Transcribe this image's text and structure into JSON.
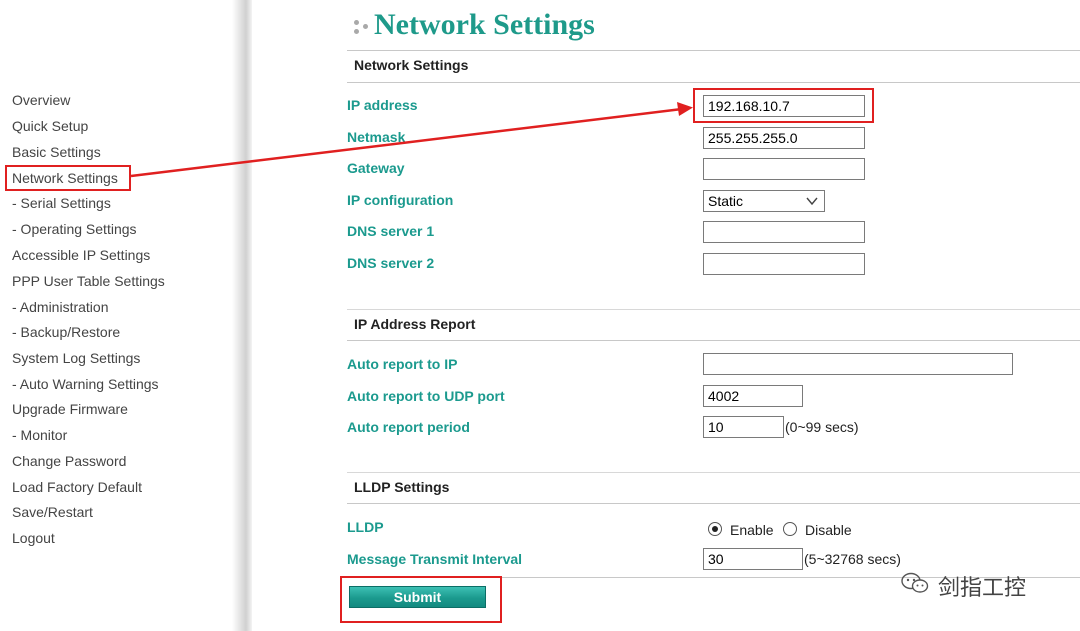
{
  "sidebar": {
    "items": [
      "Overview",
      "Quick Setup",
      "Basic Settings",
      "Network Settings",
      "- Serial Settings",
      "- Operating Settings",
      "Accessible IP Settings",
      "PPP User Table Settings",
      "- Administration",
      "- Backup/Restore",
      "System Log Settings",
      "- Auto Warning Settings",
      "Upgrade Firmware",
      "- Monitor",
      "Change Password",
      "Load Factory Default",
      "Save/Restart",
      "Logout"
    ],
    "active": "Network Settings"
  },
  "page": {
    "title": "Network Settings"
  },
  "network": {
    "header": "Network Settings",
    "ip_label": "IP address",
    "ip_value": "192.168.10.7",
    "netmask_label": "Netmask",
    "netmask_value": "255.255.255.0",
    "gateway_label": "Gateway",
    "gateway_value": "",
    "ipconf_label": "IP configuration",
    "ipconf_value": "Static",
    "dns1_label": "DNS server 1",
    "dns1_value": "",
    "dns2_label": "DNS server 2",
    "dns2_value": ""
  },
  "report": {
    "header": "IP Address Report",
    "ip_label": "Auto report to IP",
    "ip_value": "",
    "udp_label": "Auto report to UDP port",
    "udp_value": "4002",
    "period_label": "Auto report period",
    "period_value": "10",
    "period_hint": "(0~99 secs)"
  },
  "lldp": {
    "header": "LLDP Settings",
    "lldp_label": "LLDP",
    "enable_label": "Enable",
    "disable_label": "Disable",
    "selected": "Enable",
    "interval_label": "Message Transmit Interval",
    "interval_value": "30",
    "interval_hint": "(5~32768 secs)"
  },
  "submit_label": "Submit",
  "watermark": "剑指工控",
  "colors": {
    "accent": "#1b9a8e",
    "annotation": "#e02020"
  }
}
